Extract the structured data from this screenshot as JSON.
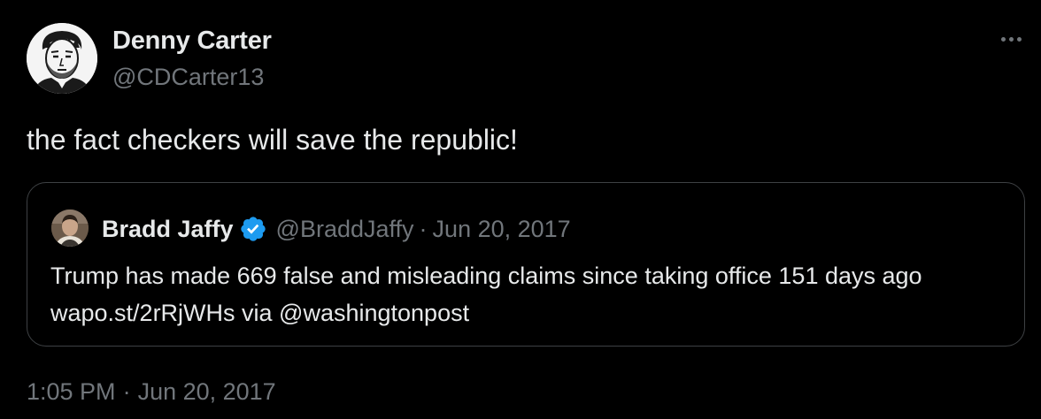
{
  "author": {
    "name": "Denny Carter",
    "handle": "@CDCarter13"
  },
  "tweet": {
    "text": "the fact checkers will save the republic!",
    "time": "1:05 PM",
    "separator": "·",
    "date": "Jun 20, 2017"
  },
  "quoted": {
    "name": "Bradd Jaffy",
    "handle": "@BraddJaffy",
    "separator": "·",
    "date": "Jun 20, 2017",
    "text": "Trump has made 669 false and misleading claims since taking office 151 days ago wapo.st/2rRjWHs via @washingtonpost",
    "verified": true
  },
  "icons": {
    "more": "more-horizontal-icon",
    "verified": "verified-badge-icon"
  },
  "colors": {
    "background": "#000000",
    "primary_text": "#e7e9ea",
    "secondary_text": "#71767b",
    "border": "#3e4144",
    "verified": "#1d9bf0"
  }
}
